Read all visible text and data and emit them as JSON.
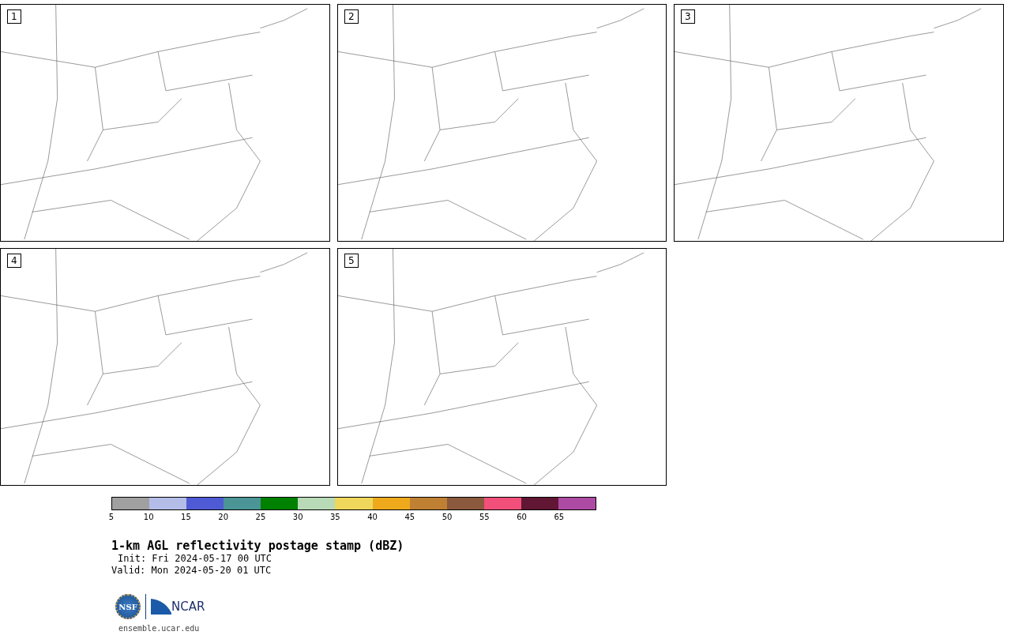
{
  "panels": [
    {
      "label": "1"
    },
    {
      "label": "2"
    },
    {
      "label": "3"
    },
    {
      "label": "4"
    },
    {
      "label": "5"
    }
  ],
  "colorbar": {
    "bins": [
      {
        "color": "#a0a0a0"
      },
      {
        "color": "#b4bce8"
      },
      {
        "color": "#4f5bd5"
      },
      {
        "color": "#4b9597"
      },
      {
        "color": "#008100"
      },
      {
        "color": "#b8dab6"
      },
      {
        "color": "#eed75b"
      },
      {
        "color": "#eeaa1c"
      },
      {
        "color": "#bf8033"
      },
      {
        "color": "#8b5a3e"
      },
      {
        "color": "#f24f7a"
      },
      {
        "color": "#611633"
      },
      {
        "color": "#ad4ba4"
      }
    ],
    "ticks": [
      "5",
      "10",
      "15",
      "20",
      "25",
      "30",
      "35",
      "40",
      "45",
      "50",
      "55",
      "60",
      "65"
    ]
  },
  "title": "1-km AGL reflectivity postage stamp (dBZ)",
  "init": "Init: Fri 2024-05-17 00 UTC",
  "valid": "Valid: Mon 2024-05-20 01 UTC",
  "logos": {
    "nsf": "NSF",
    "ncar": "NCAR"
  },
  "footer": "ensemble.ucar.edu"
}
